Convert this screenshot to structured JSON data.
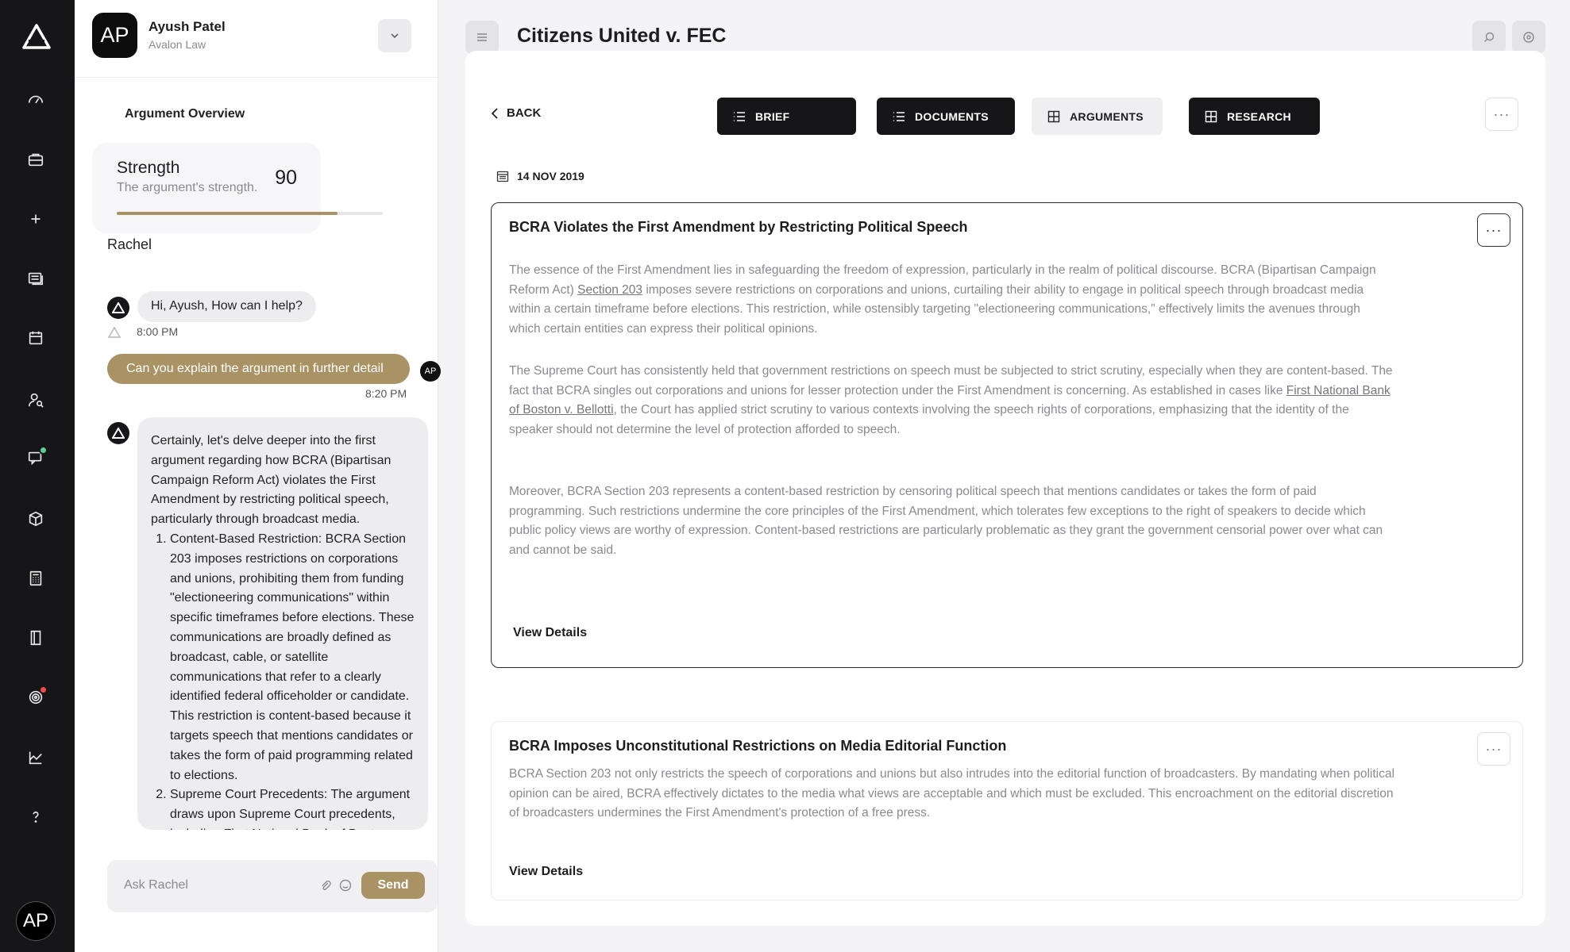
{
  "user": {
    "initials": "AP",
    "name": "Ayush Patel",
    "org": "Avalon Law"
  },
  "panel": {
    "overview_title": "Argument Overview",
    "strength": {
      "label": "Strength",
      "sub": "The argument's strength.",
      "value": "90",
      "progress": 0.83
    },
    "bot_name": "Rachel"
  },
  "chat": {
    "greeting": "Hi, Ayush, How can I help?",
    "greeting_time": "8:00 PM",
    "user_msg": "Can you explain the argument in further detail",
    "user_time": "8:20 PM",
    "user_initials": "AP",
    "reply_intro": "Certainly, let's delve deeper into the first argument regarding how BCRA (Bipartisan Campaign Reform Act) violates the First Amendment by restricting political speech, particularly through broadcast media.",
    "reply_points": [
      "Content-Based Restriction: BCRA Section 203 imposes restrictions on corporations and unions, prohibiting them from funding \"electioneering communications\" within specific timeframes before elections. These communications are broadly defined as broadcast, cable, or satellite communications that refer to a clearly identified federal officeholder or candidate. This restriction is content-based because it targets speech that mentions candidates or takes the form of paid programming related to elections.",
      "Supreme Court Precedents: The argument draws upon Supreme Court precedents, including First National Bank of Boston v. Bellotti, which established that the identity of the speaker should not determine the level of protection afforded to speech."
    ],
    "input_placeholder": "Ask Rachel",
    "send_label": "Send"
  },
  "header": {
    "title": "Citizens United v. FEC"
  },
  "nav": {
    "back_label": "BACK",
    "tabs": [
      "BRIEF",
      "DOCUMENTS",
      "ARGUMENTS",
      "RESEARCH"
    ]
  },
  "date": "14 NOV 2019",
  "arguments": [
    {
      "title": "BCRA Violates the First Amendment by Restricting Political Speech",
      "p1_before": "The essence of the First Amendment lies in safeguarding the freedom of expression, particularly in the realm of political discourse. BCRA (Bipartisan Campaign Reform Act) ",
      "p1_link": "Section 203",
      "p1_after": " imposes severe restrictions on corporations and unions, curtailing their ability to engage in political speech through broadcast media within a certain timeframe before elections. This restriction, while ostensibly targeting \"electioneering communications,\" effectively limits the avenues through which certain entities can express their political opinions.",
      "p2_before": "The Supreme Court has consistently held that government restrictions on speech must be subjected to strict scrutiny, especially when they are content-based. The fact that BCRA singles out corporations and unions for lesser protection under the First Amendment is concerning. As established in cases like ",
      "p2_link": "First National Bank of Boston v. Bellotti",
      "p2_after": ", the Court has applied strict scrutiny to various contexts involving the speech rights of corporations, emphasizing that the identity of the speaker should not determine the level of protection afforded to speech.",
      "p3": "Moreover, BCRA Section 203 represents a content-based restriction by censoring political speech that mentions candidates or takes the form of paid programming. Such restrictions undermine the core principles of the First Amendment, which tolerates few exceptions to the right of speakers to decide which public policy views are worthy of expression. Content-based restrictions are particularly problematic as they grant the government censorial power over what can and cannot be said.",
      "view_label": "View Details"
    },
    {
      "title": "BCRA Imposes Unconstitutional Restrictions on Media Editorial Function",
      "p1": "BCRA Section 203 not only restricts the speech of corporations and unions but also intrudes into the editorial function of broadcasters. By mandating when political opinion can be aired, BCRA effectively dictates to the media what views are acceptable and which must be excluded. This encroachment on the editorial discretion of broadcasters undermines the First Amendment's protection of a free press.",
      "view_label": "View Details"
    }
  ],
  "colors": {
    "accent": "#a99364",
    "rail": "#161618",
    "notify_green": "#5ad19a",
    "notify_red": "#f24b4b"
  },
  "rail_icons": [
    "logo-icon",
    "dashboard-icon",
    "briefcase-icon",
    "plus-icon",
    "documents-icon",
    "calendar-icon",
    "user-search-icon",
    "chat-icon",
    "box-icon",
    "calculator-icon",
    "book-icon",
    "target-icon",
    "analytics-icon",
    "help-icon"
  ]
}
